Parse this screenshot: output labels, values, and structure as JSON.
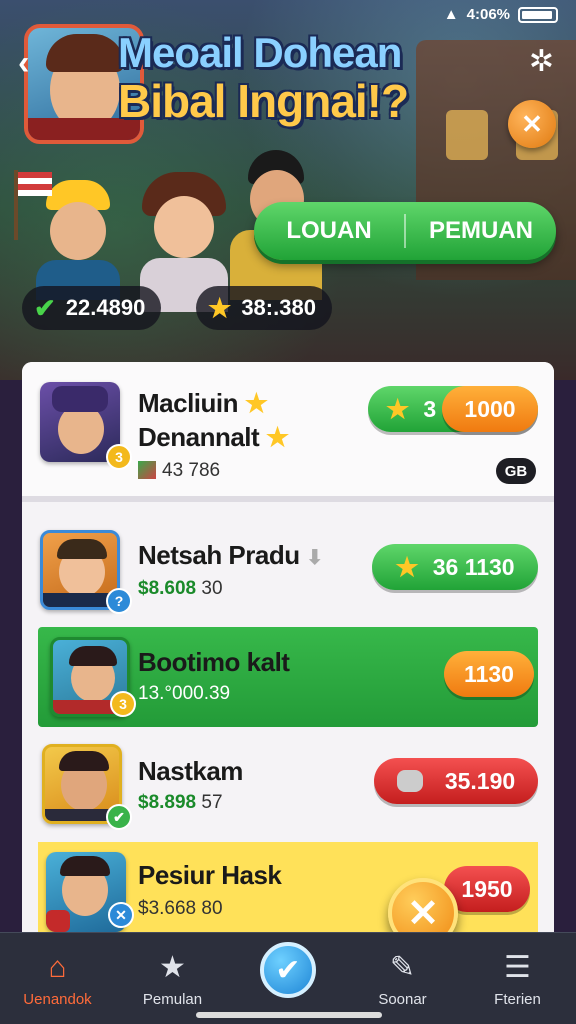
{
  "status_bar": {
    "signal_battery_text": "4:06%"
  },
  "header": {
    "title_line1": "Meoail Dohean",
    "title_line2": "Bibal Ingnai!?"
  },
  "toggle": {
    "left_label": "LOUAN",
    "right_label": "PEMUAN"
  },
  "stats": {
    "checks": "22.4890",
    "stars": "38:.380"
  },
  "leaderboard": [
    {
      "name_line1": "Macliuin",
      "name_line2": "Denannalt",
      "sub": "43 786",
      "badge": "3",
      "button": "1000",
      "button_prefix": "3",
      "tag": "GB"
    },
    {
      "name": "Netsah Pradu",
      "sub_green": "$8.608",
      "sub_rest": "30",
      "button": "36 1130"
    },
    {
      "name": "Bootimo kalt",
      "sub": "13.°000.39",
      "button": "1130"
    },
    {
      "name": "Nastkam",
      "sub_green": "$8.898",
      "sub_rest": "57",
      "button": "35.190"
    },
    {
      "name": "Pesiur Hask",
      "sub": "$3.668 80",
      "button": "1950"
    }
  ],
  "tabs": [
    {
      "label": "Uenandok",
      "icon": "home-icon"
    },
    {
      "label": "Pemulan",
      "icon": "star-icon"
    },
    {
      "label": "",
      "icon": "check-icon"
    },
    {
      "label": "Soonar",
      "icon": "pencil-icon"
    },
    {
      "label": "Fterien",
      "icon": "list-icon"
    }
  ],
  "colors": {
    "accent_green": "#21a337",
    "accent_orange": "#f07a10",
    "accent_red": "#c41e1e",
    "tab_active": "#ff6b3a"
  }
}
